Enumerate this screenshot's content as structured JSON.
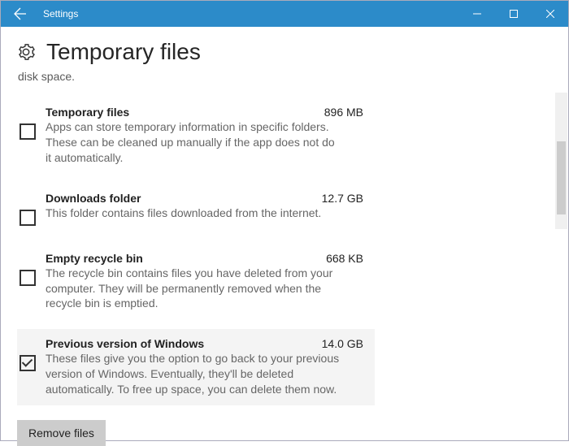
{
  "titlebar": {
    "app_name": "Settings"
  },
  "header": {
    "title": "Temporary files"
  },
  "truncated_line": "disk space.",
  "items": [
    {
      "label": "Temporary files",
      "size": "896 MB",
      "desc": "Apps can store temporary information in specific folders. These can be cleaned up manually if the app does not do it automatically.",
      "checked": false,
      "selected": false
    },
    {
      "label": "Downloads folder",
      "size": "12.7 GB",
      "desc": "This folder contains files downloaded from the internet.",
      "checked": false,
      "selected": false
    },
    {
      "label": "Empty recycle bin",
      "size": "668 KB",
      "desc": "The recycle bin contains files you have deleted from your computer. They will be permanently removed when the recycle bin is emptied.",
      "checked": false,
      "selected": false
    },
    {
      "label": "Previous version of Windows",
      "size": "14.0 GB",
      "desc": "These files give you the option to go back to your previous version of Windows. Eventually, they'll be deleted automatically. To free up space, you can delete them now.",
      "checked": true,
      "selected": true
    }
  ],
  "remove_button_label": "Remove files"
}
